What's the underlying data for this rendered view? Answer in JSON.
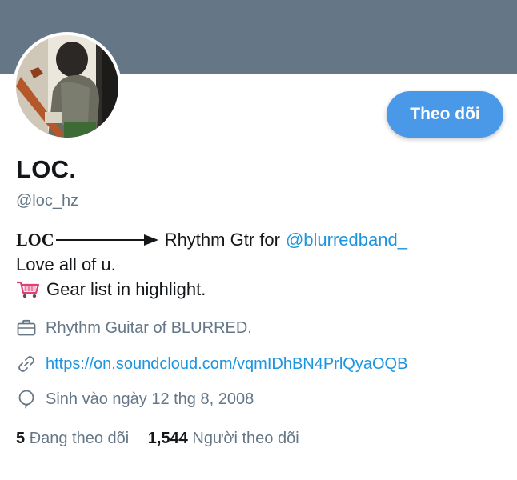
{
  "profile": {
    "name": "LOC.",
    "handle": "@loc_hz",
    "follow_label": "Theo dõi",
    "bio": {
      "prefix": "LOC",
      "role_text": "Rhythm Gtr for",
      "mention": "@blurredband_",
      "line2": "Love all of u.",
      "line3": "Gear list in highlight."
    },
    "meta": {
      "work": "Rhythm Guitar of BLURRED.",
      "website": "https://on.soundcloud.com/vqmIDhBN4PrlQyaOQB",
      "birthday": "Sinh vào ngày 12 thg 8, 2008"
    },
    "stats": {
      "following_count": "5",
      "following_label": "Đang theo dõi",
      "followers_count": "1,544",
      "followers_label": "Người theo dõi"
    }
  },
  "colors": {
    "banner": "#657786",
    "accent": "#4a99e9",
    "link": "#1b95e0",
    "secondary_text": "#657786"
  },
  "icons": [
    "briefcase-icon",
    "link-icon",
    "balloon-icon",
    "shopping-cart-icon",
    "arrow-right-icon"
  ]
}
